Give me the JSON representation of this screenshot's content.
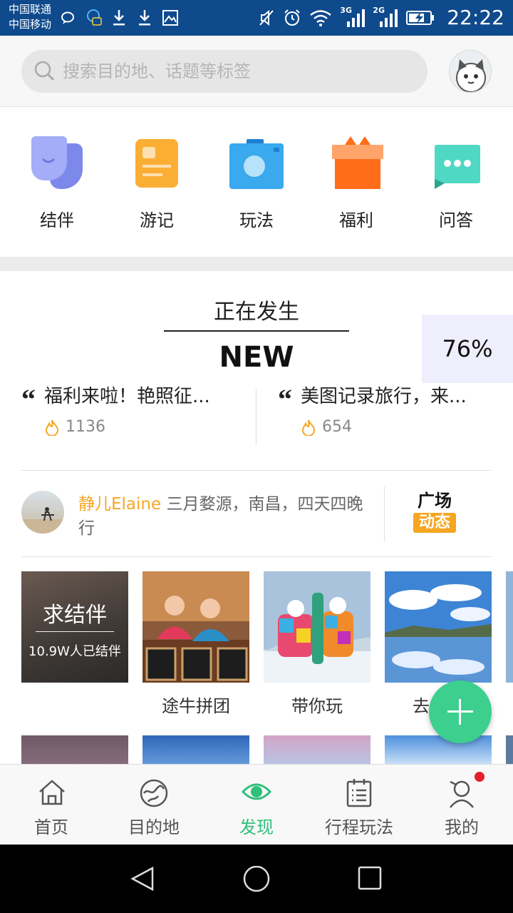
{
  "status_bar": {
    "carrier_1": "中国联通",
    "carrier_2": "中国移动",
    "net_1": "3G",
    "net_2": "2G",
    "time": "22:22"
  },
  "search": {
    "placeholder": "搜索目的地、话题等标签"
  },
  "categories": [
    {
      "label": "结伴",
      "icon": "partner-icon",
      "color": "#8f9bf2"
    },
    {
      "label": "游记",
      "icon": "travel-notes-icon",
      "color": "#f9a825"
    },
    {
      "label": "玩法",
      "icon": "camera-icon",
      "color": "#3aa9ee"
    },
    {
      "label": "福利",
      "icon": "gift-icon",
      "color": "#ff6d1a"
    },
    {
      "label": "问答",
      "icon": "chat-bubble-icon",
      "color": "#4fd8c4"
    }
  ],
  "happening": {
    "title": "正在发生",
    "badge": "NEW",
    "progress_text": "76%",
    "items": [
      {
        "quote": "“",
        "title": "福利来啦！艳照征...",
        "count": "1136"
      },
      {
        "quote": "“",
        "title": "美图记录旅行，来...",
        "count": "654"
      }
    ]
  },
  "feed": {
    "user": "静儿Elaine",
    "text": " 三月婺源，南昌，四天四晚行",
    "plaza_top": "广场",
    "plaza_bottom": "动态"
  },
  "cards": [
    {
      "title": "求结伴",
      "subtitle": "10.9W人已结伴",
      "label": ""
    },
    {
      "label": "途牛拼团"
    },
    {
      "label": "带你玩"
    },
    {
      "label": "去云南"
    }
  ],
  "bottom_nav": [
    {
      "label": "首页",
      "icon": "home-icon",
      "active": false
    },
    {
      "label": "目的地",
      "icon": "globe-icon",
      "active": false
    },
    {
      "label": "发现",
      "icon": "eye-icon",
      "active": true
    },
    {
      "label": "行程玩法",
      "icon": "itinerary-icon",
      "active": false
    },
    {
      "label": "我的",
      "icon": "profile-icon",
      "active": false
    }
  ],
  "colors": {
    "status_bar": "#0e4a8c",
    "accent_green": "#2fbf7a",
    "accent_orange": "#f5a623",
    "fab": "#3ccf8e"
  }
}
